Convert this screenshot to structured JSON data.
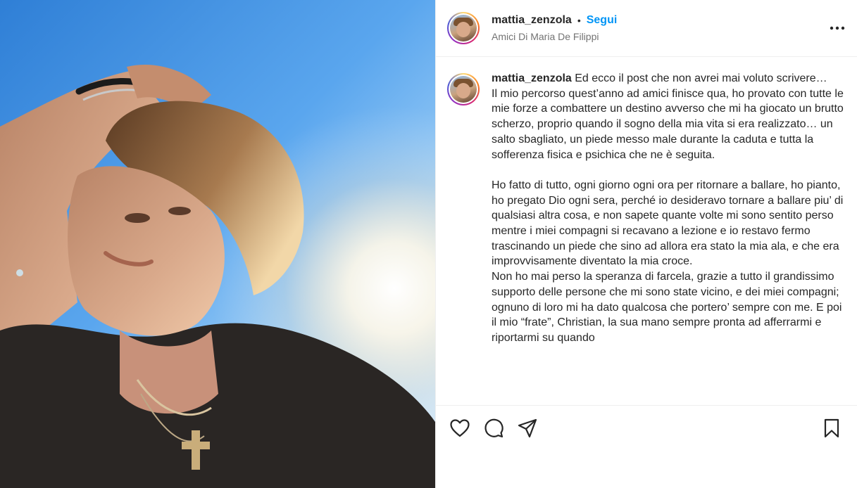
{
  "post": {
    "username": "mattia_zenzola",
    "separator": "•",
    "follow_label": "Segui",
    "location": "Amici Di Maria De Filippi",
    "more_icon": "more-horizontal-icon"
  },
  "caption": {
    "username": "mattia_zenzola",
    "text": " Ed ecco il post che non avrei mai voluto scrivere…\nIl mio percorso quest’anno ad amici finisce qua, ho provato con tutte le mie forze a combattere un destino avverso che mi ha giocato un brutto scherzo, proprio quando il sogno della mia vita si era realizzato… un salto sbagliato, un piede messo male durante la caduta e tutta la sofferenza fisica e psichica che ne è seguita.\n\nHo fatto di tutto, ogni giorno ogni ora per ritornare a ballare, ho pianto, ho pregato Dio ogni sera, perché io desideravo tornare a ballare piu’ di qualsiasi altra cosa, e non sapete quante volte mi sono sentito perso mentre i miei compagni si recavano a lezione e io restavo fermo trascinando un piede che sino ad allora era stato la mia ala, e che era improvvisamente diventato la mia croce.\nNon ho mai perso la speranza di farcela, grazie a tutto il grandissimo supporto delle persone che mi sono state vicino, e dei miei compagni; ognuno di loro mi ha dato qualcosa che portero’ sempre con me. E poi il mio “frate”, Christian, la sua mano sempre pronta ad afferrarmi e riportarmi su quando"
  },
  "actions": {
    "like_icon": "heart-icon",
    "comment_icon": "comment-icon",
    "share_icon": "share-icon",
    "save_icon": "bookmark-icon"
  },
  "colors": {
    "follow": "#0095f6",
    "text": "#262626",
    "muted": "#737373",
    "border": "#efefef"
  }
}
